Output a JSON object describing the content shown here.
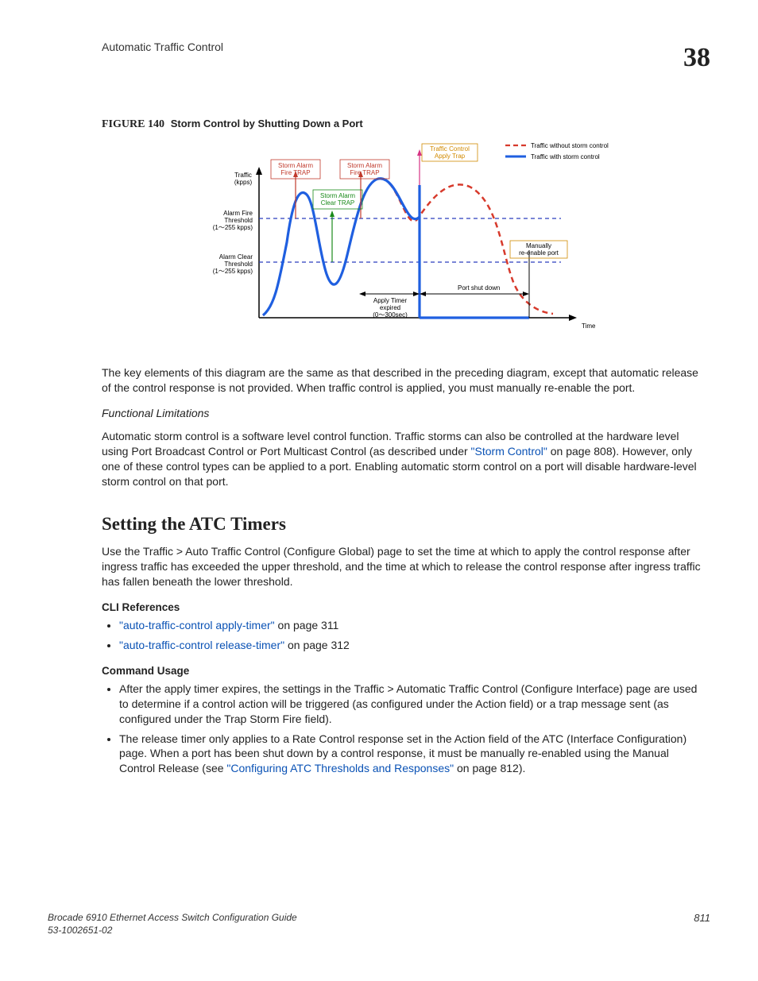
{
  "header": {
    "title": "Automatic Traffic Control",
    "chapter": "38"
  },
  "figure": {
    "label": "FIGURE 140",
    "caption": "Storm Control by Shutting Down a Port"
  },
  "diagram": {
    "legend_without": "Traffic without storm control",
    "legend_with": "Traffic with storm control",
    "y_axis": "Traffic (kpps)",
    "x_axis": "Time",
    "alarm_fire": "Alarm Fire Threshold (1～255 kpps)",
    "alarm_clear": "Alarm Clear Threshold (1～255 kpps)",
    "storm_fire_trap": "Storm Alarm Fire TRAP",
    "storm_clear_trap": "Storm Alarm Clear TRAP",
    "tc_apply_trap": "Traffic Control Apply Trap",
    "apply_timer": "Apply Timer expired (0～300sec)",
    "port_shutdown": "Port shut down",
    "manual_reenable": "Manually re-enable port"
  },
  "body": {
    "para1": "The key elements of this diagram are the same as that described in the preceding diagram, except that automatic release of the control response is not provided. When traffic control is applied, you must manually re-enable the port.",
    "func_lim_head": "Functional Limitations",
    "para2a": "Automatic storm control is a software level control function. Traffic storms can also be controlled at the hardware level using Port Broadcast Control or Port Multicast Control (as described under ",
    "para2_link": "\"Storm Control\"",
    "para2b": " on page 808). However, only one of these control types can be applied to a port. Enabling automatic storm control on a port will disable hardware-level storm control on that port.",
    "section_title": "Setting the ATC Timers",
    "para3": "Use the Traffic > Auto Traffic Control (Configure Global) page to set the time at which to apply the control response after ingress traffic has exceeded the upper threshold, and the time at which to release the control response after ingress traffic has fallen beneath the lower threshold.",
    "cli_ref_head": "CLI References",
    "cli_ref1_link": "\"auto-traffic-control apply-timer\"",
    "cli_ref1_tail": " on page 311",
    "cli_ref2_link": "\"auto-traffic-control release-timer\"",
    "cli_ref2_tail": " on page 312",
    "cmd_usage_head": "Command Usage",
    "cmd1": "After the apply timer expires, the settings in the Traffic > Automatic Traffic Control (Configure Interface) page are used to determine if a control action will be triggered (as configured under the Action field) or a trap message sent (as configured under the Trap Storm Fire field).",
    "cmd2a": "The release timer only applies to a Rate Control response set in the Action field of the ATC (Interface Configuration) page. When a port has been shut down by a control response, it must be manually re-enabled using the Manual Control Release (see ",
    "cmd2_link": "\"Configuring ATC Thresholds and Responses\"",
    "cmd2b": " on page 812)."
  },
  "footer": {
    "line1": "Brocade 6910 Ethernet Access Switch Configuration Guide",
    "line2": "53-1002651-02",
    "page": "811"
  }
}
